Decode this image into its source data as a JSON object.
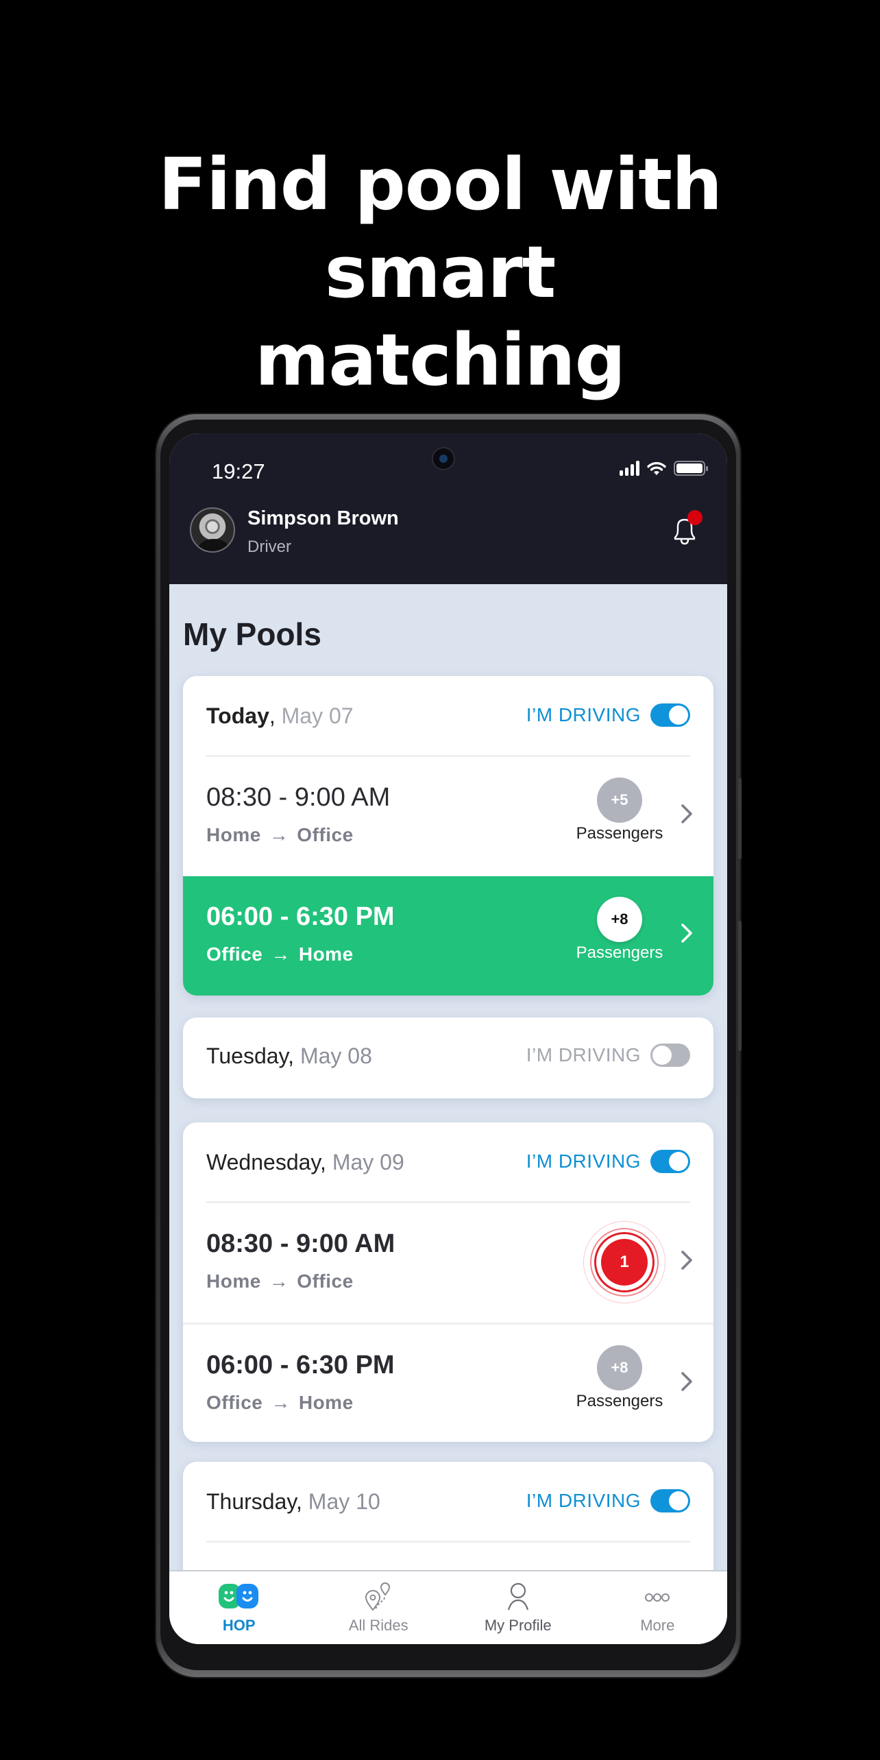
{
  "headline": "Find pool with smart matching",
  "colors": {
    "accent_blue": "#0f94dc",
    "active_green": "#21c27c",
    "alert_red": "#e41b24",
    "header_bg": "#1b1b28"
  },
  "status_bar": {
    "time": "19:27",
    "icons": [
      "signal-icon",
      "wifi-icon",
      "battery-icon"
    ]
  },
  "header": {
    "user_name": "Simpson Brown",
    "user_role": "Driver",
    "notification_icon": "bell-icon",
    "has_notification": true
  },
  "page_title": "My Pools",
  "days": [
    {
      "day": "Today",
      "date": "May 07",
      "driving_label": "I’M DRIVING",
      "driving_on": true,
      "rides": [
        {
          "time": "08:30 - 9:00 AM",
          "from": "Home",
          "to": "Office",
          "passengers": "+5",
          "passengers_label": "Passengers",
          "active": false
        },
        {
          "time": "06:00 - 6:30 PM",
          "from": "Office",
          "to": "Home",
          "passengers": "+8",
          "passengers_label": "Passengers",
          "active": true
        }
      ]
    },
    {
      "day": "Tuesday",
      "date": "May 08",
      "driving_label": "I’M DRIVING",
      "driving_on": false,
      "rides": []
    },
    {
      "day": "Wednesday",
      "date": "May 09",
      "driving_label": "I’M DRIVING",
      "driving_on": true,
      "rides": [
        {
          "time": "08:30 - 9:00 AM",
          "from": "Home",
          "to": "Office",
          "alert_count": "1",
          "active": false
        },
        {
          "time": "06:00 - 6:30 PM",
          "from": "Office",
          "to": "Home",
          "passengers": "+8",
          "passengers_label": "Passengers",
          "active": false
        }
      ]
    },
    {
      "day": "Thursday",
      "date": "May 10",
      "driving_label": "I’M DRIVING",
      "driving_on": true,
      "rides": []
    }
  ],
  "route_arrow": "→",
  "bottom_nav": [
    {
      "label": "HOP",
      "icon": "hop-logo-icon",
      "active": true
    },
    {
      "label": "All Rides",
      "icon": "route-pins-icon",
      "active": false
    },
    {
      "label": "My Profile",
      "icon": "user-icon",
      "active": false
    },
    {
      "label": "More",
      "icon": "more-dots-icon",
      "active": false
    }
  ]
}
